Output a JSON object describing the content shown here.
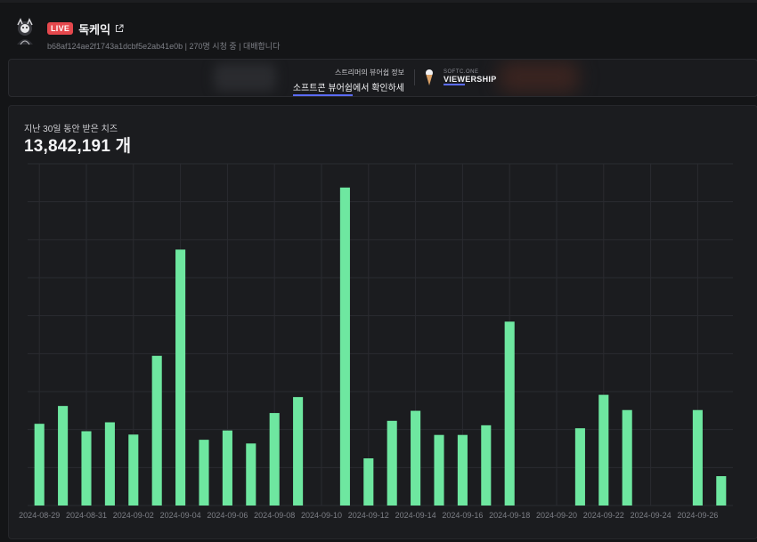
{
  "header": {
    "live_badge": "LIVE",
    "channel_name": "독케익",
    "subtitle": "b68af124ae2f1743a1dcbf5e2ab41e0b | 270명 시청 중 | 대배합니다"
  },
  "banner": {
    "line1": "스트리머의 뷰어쉽 정보",
    "line2_highlight": "소프트콘 뷰어쉽",
    "line2_rest": "에서 확인하세요!",
    "brand_small": "SOFTC.ONE",
    "brand_highlight": "VIEW",
    "brand_rest": "ERSHIP"
  },
  "card": {
    "label": "지난 30일 동안 받은 치즈",
    "total": "13,842,191 개"
  },
  "colors": {
    "bar": "#6ee7a0",
    "live": "#e5484d",
    "accent": "#5b6cff"
  },
  "chart_data": {
    "type": "bar",
    "x": [
      "2024-08-29",
      "2024-08-30",
      "2024-08-31",
      "2024-09-01",
      "2024-09-02",
      "2024-09-03",
      "2024-09-04",
      "2024-09-05",
      "2024-09-06",
      "2024-09-07",
      "2024-09-08",
      "2024-09-09",
      "2024-09-10",
      "2024-09-11",
      "2024-09-12",
      "2024-09-13",
      "2024-09-14",
      "2024-09-15",
      "2024-09-16",
      "2024-09-17",
      "2024-09-18",
      "2024-09-19",
      "2024-09-20",
      "2024-09-21",
      "2024-09-22",
      "2024-09-23",
      "2024-09-24",
      "2024-09-25",
      "2024-09-26",
      "2024-09-27"
    ],
    "values": [
      220,
      268,
      200,
      224,
      191,
      403,
      689,
      177,
      202,
      167,
      249,
      292,
      0,
      856,
      127,
      228,
      255,
      190,
      190,
      216,
      495,
      0,
      0,
      208,
      298,
      257,
      0,
      0,
      257,
      79
    ],
    "tick_labels": [
      "2024-08-29",
      "2024-08-31",
      "2024-09-02",
      "2024-09-04",
      "2024-09-06",
      "2024-09-08",
      "2024-09-10",
      "2024-09-12",
      "2024-09-14",
      "2024-09-16",
      "2024-09-18",
      "2024-09-20",
      "2024-09-22",
      "2024-09-24",
      "2024-09-26"
    ],
    "ylim": [
      0,
      920
    ],
    "grid": true,
    "legend": "none"
  }
}
